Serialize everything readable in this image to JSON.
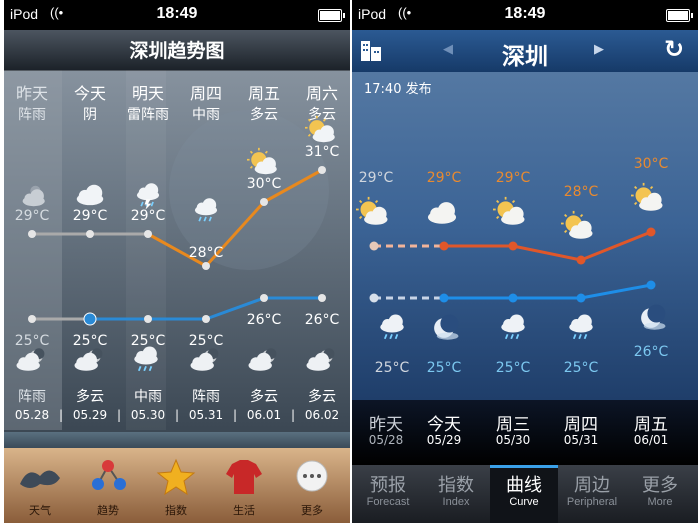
{
  "status_bar": {
    "carrier": "iPod",
    "time": "18:49"
  },
  "left": {
    "title": "深圳趋势图",
    "days": [
      {
        "day": "昨天",
        "day_weather": "阵雨",
        "night_weather": "阵雨",
        "date": "05.28",
        "icon_day": "cloud-sun-icon",
        "icon_night": "cloud-moon-icon"
      },
      {
        "day": "今天",
        "day_weather": "阴",
        "night_weather": "多云",
        "date": "05.29",
        "icon_day": "cloud-icon",
        "icon_night": "cloud-moon-icon"
      },
      {
        "day": "明天",
        "day_weather": "雷阵雨",
        "night_weather": "中雨",
        "date": "05.30",
        "icon_day": "thunder-rain-icon",
        "icon_night": "rain-icon"
      },
      {
        "day": "周四",
        "day_weather": "中雨",
        "night_weather": "阵雨",
        "date": "05.31",
        "icon_day": "rain-icon",
        "icon_night": "cloud-moon-icon"
      },
      {
        "day": "周五",
        "day_weather": "多云",
        "night_weather": "多云",
        "date": "06.01",
        "icon_day": "sun-cloud-icon",
        "icon_night": "cloud-moon-icon"
      },
      {
        "day": "周六",
        "day_weather": "多云",
        "night_weather": "多云",
        "date": "06.02",
        "icon_day": "sun-cloud-icon",
        "icon_night": "cloud-moon-icon"
      }
    ],
    "high_labels": [
      "29°C",
      "29°C",
      "29°C",
      "28°C",
      "30°C",
      "31°C"
    ],
    "low_labels": [
      "25°C",
      "25°C",
      "25°C",
      "25°C",
      "26°C",
      "26°C"
    ],
    "nav": [
      {
        "label": "天气",
        "icon": "weather-icon"
      },
      {
        "label": "趋势",
        "icon": "trend-icon"
      },
      {
        "label": "指数",
        "icon": "star-icon"
      },
      {
        "label": "生活",
        "icon": "shirt-icon"
      },
      {
        "label": "更多",
        "icon": "more-icon"
      }
    ],
    "colors": {
      "past": "#aaaaaa",
      "high": "#e8891e",
      "low": "#2a8ad6"
    }
  },
  "right": {
    "title": "深圳",
    "published": "17:40 发布",
    "high_labels": [
      "29°C",
      "29°C",
      "29°C",
      "28°C",
      "30°C"
    ],
    "low_labels": [
      "25°C",
      "25°C",
      "25°C",
      "25°C",
      "26°C"
    ],
    "days": [
      {
        "day": "昨天",
        "date": "05/28",
        "icon_day": "sun-cloud-icon",
        "icon_night": "rain-icon"
      },
      {
        "day": "今天",
        "date": "05/29",
        "icon_day": "cloud-icon",
        "icon_night": "moon-icon"
      },
      {
        "day": "周三",
        "date": "05/30",
        "icon_day": "sun-cloud-icon",
        "icon_night": "rain-icon"
      },
      {
        "day": "周四",
        "date": "05/31",
        "icon_day": "sun-cloud-icon",
        "icon_night": "rain-icon"
      },
      {
        "day": "周五",
        "date": "06/01",
        "icon_day": "sun-cloud-icon",
        "icon_night": "moon-icon"
      }
    ],
    "tabs": [
      {
        "label": "预报",
        "sub": "Forecast"
      },
      {
        "label": "指数",
        "sub": "Index"
      },
      {
        "label": "曲线",
        "sub": "Curve"
      },
      {
        "label": "周边",
        "sub": "Peripheral"
      },
      {
        "label": "更多",
        "sub": "More"
      }
    ],
    "colors": {
      "high": "#e0572a",
      "low": "#1e8ee8",
      "high_text": "#e88a30",
      "low_text": "#7cc8f0"
    }
  },
  "chart_data": [
    {
      "type": "line",
      "x": [
        "昨天",
        "今天",
        "明天",
        "周四",
        "周五",
        "周六"
      ],
      "series": [
        {
          "values": [
            29,
            29,
            29,
            28,
            30,
            31
          ]
        },
        {
          "values": [
            25,
            25,
            25,
            25,
            26,
            26
          ]
        }
      ]
    },
    {
      "type": "line",
      "x": [
        "昨天",
        "今天",
        "周三",
        "周四",
        "周五"
      ],
      "series": [
        {
          "values": [
            29,
            29,
            29,
            28,
            30
          ]
        },
        {
          "values": [
            25,
            25,
            25,
            25,
            26
          ]
        }
      ]
    }
  ]
}
